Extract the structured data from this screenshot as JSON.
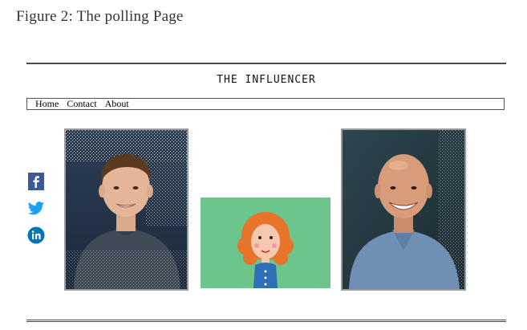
{
  "caption": "Figure 2: The polling Page",
  "site": {
    "title": "THE INFLUENCER"
  },
  "nav": {
    "items": [
      {
        "label": "Home"
      },
      {
        "label": "Contact"
      },
      {
        "label": "About"
      }
    ]
  },
  "social": [
    {
      "icon": "facebook-icon",
      "color": "#3b5998"
    },
    {
      "icon": "twitter-icon",
      "color": "#1da1f2"
    },
    {
      "icon": "linkedin-icon",
      "color": "#0077b5"
    }
  ],
  "colors": {
    "rule": "#4a4a4a",
    "frame": "#9a9a9a",
    "cartoon_bg": "#6cc58a"
  }
}
